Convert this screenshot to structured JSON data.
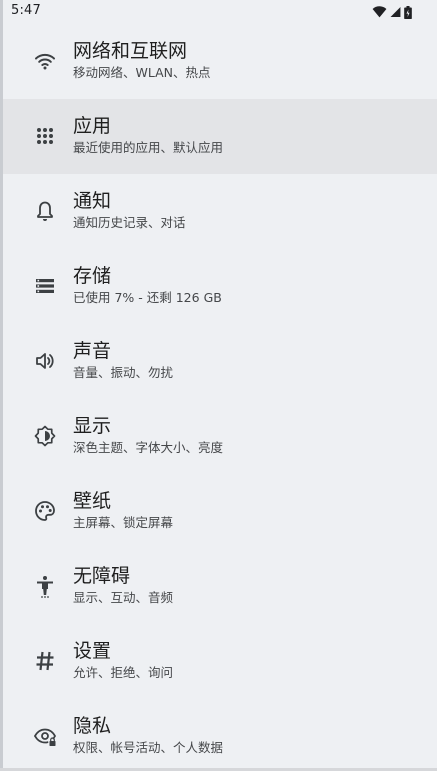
{
  "status_bar": {
    "time": "5:47"
  },
  "settings": {
    "items": [
      {
        "icon": "wifi-icon",
        "title": "网络和互联网",
        "summary": "移动网络、WLAN、热点",
        "selected": false
      },
      {
        "icon": "apps-icon",
        "title": "应用",
        "summary": "最近使用的应用、默认应用",
        "selected": true
      },
      {
        "icon": "bell-icon",
        "title": "通知",
        "summary": "通知历史记录、对话",
        "selected": false
      },
      {
        "icon": "storage-icon",
        "title": "存储",
        "summary": "已使用 7% - 还剩 126 GB",
        "selected": false
      },
      {
        "icon": "volume-icon",
        "title": "声音",
        "summary": "音量、振动、勿扰",
        "selected": false
      },
      {
        "icon": "brightness-icon",
        "title": "显示",
        "summary": "深色主题、字体大小、亮度",
        "selected": false
      },
      {
        "icon": "palette-icon",
        "title": "壁纸",
        "summary": "主屏幕、锁定屏幕",
        "selected": false
      },
      {
        "icon": "accessibility-icon",
        "title": "无障碍",
        "summary": "显示、互动、音频",
        "selected": false
      },
      {
        "icon": "hash-icon",
        "title": "设置",
        "summary": "允许、拒绝、询问",
        "selected": false
      },
      {
        "icon": "privacy-eye-icon",
        "title": "隐私",
        "summary": "权限、帐号活动、个人数据",
        "selected": false
      }
    ]
  },
  "colors": {
    "background": "#eef0f3",
    "selected_row": "#e3e4e7",
    "title_text": "#1f1f1f",
    "summary_text": "#45474a",
    "icon": "#3c4043"
  }
}
